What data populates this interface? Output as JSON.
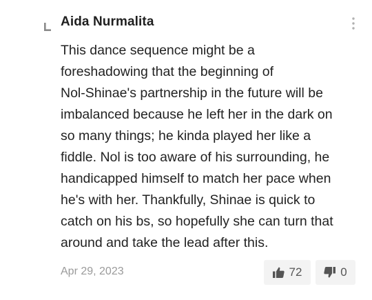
{
  "comment": {
    "author": "Aida Nurmalita",
    "reply_icon": "reply-corner-icon",
    "menu_icon": "more-vertical-icon",
    "body_lines": [
      "This dance sequence might be a",
      "foreshadowing that the beginning of",
      "Nol-Shinae's partnership in the future will be",
      "imbalanced because he left her in the dark on",
      "so many things; he kinda played her like a",
      "fiddle. Nol is too aware of his surrounding, he",
      "handicapped himself to match her pace when",
      "he's with her. Thankfully, Shinae is quick to",
      "catch on his bs, so hopefully she can turn that",
      "around and take the lead after this."
    ],
    "date": "Apr 29, 2023",
    "likes": {
      "icon": "thumbs-up-icon",
      "count": "72"
    },
    "dislikes": {
      "icon": "thumbs-down-icon",
      "count": "0"
    }
  },
  "colors": {
    "text": "#222222",
    "muted": "#9a9a9a",
    "button_bg": "#f3f3f3",
    "icon": "#555555"
  }
}
